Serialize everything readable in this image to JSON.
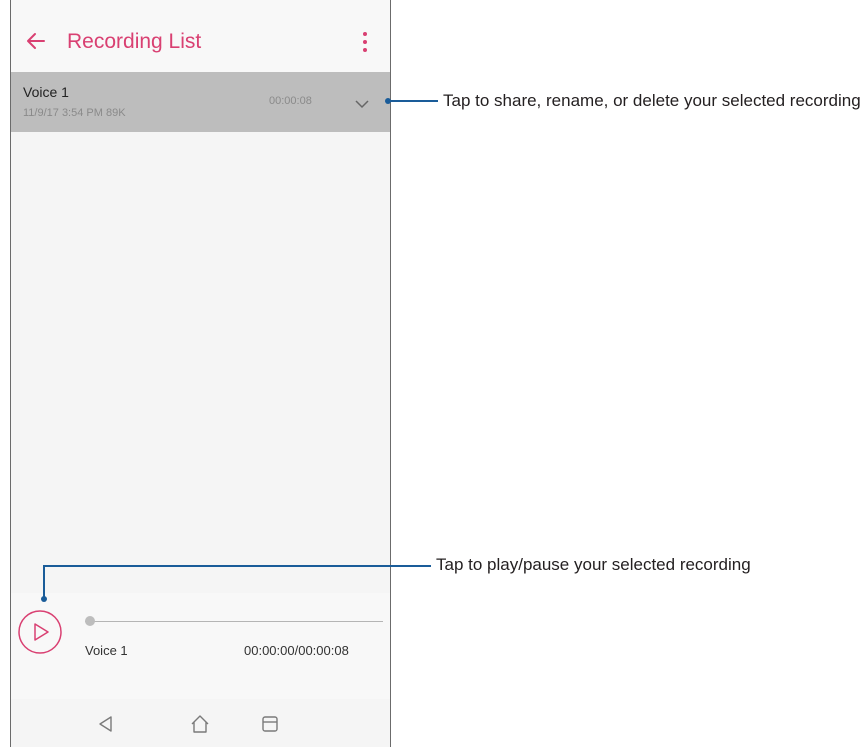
{
  "app_bar": {
    "title": "Recording List",
    "back_icon": "arrow-left-icon",
    "menu_icon": "more-vertical-icon"
  },
  "recordings": [
    {
      "name": "Voice 1",
      "meta": "11/9/17 3:54 PM  89K",
      "duration": "00:00:08",
      "action_icon": "chevron-down-icon"
    }
  ],
  "player": {
    "title": "Voice 1",
    "time": "00:00:00/00:00:08",
    "progress": 0,
    "play_icon": "play-icon"
  },
  "nav_bar": {
    "icons": [
      "back-triangle-icon",
      "home-icon",
      "recent-apps-icon"
    ]
  },
  "callouts": [
    {
      "text": "Tap to share, rename, or delete your selected recording"
    },
    {
      "text": "Tap to play/pause your selected recording"
    }
  ],
  "colors": {
    "accent": "#d94072",
    "callout_line": "#1a5c99",
    "selected_row": "#bdbdbd",
    "background": "#f5f5f5"
  }
}
